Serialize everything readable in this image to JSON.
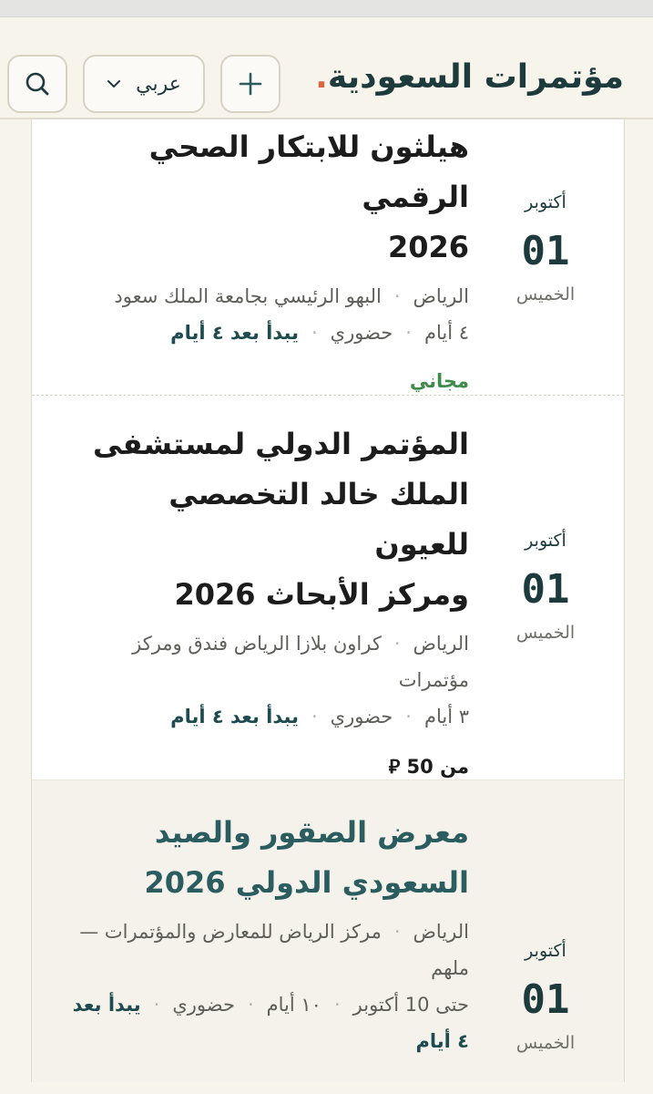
{
  "header": {
    "logo_text": "مؤتمرات السعودية",
    "logo_dot": ".",
    "add_button_icon": "plus-icon",
    "language_label": "عربي",
    "language_icon": "chevron-down-icon",
    "search_icon": "search-icon"
  },
  "colors": {
    "accent": "#d9663f",
    "brand_dark": "#1d3a3c",
    "brand_teal": "#2b5d60",
    "free_green": "#3f8b4c"
  },
  "events": [
    {
      "month": "أكتوبر",
      "day": "01",
      "weekday": "الخميس",
      "title_line1": "هيلثون للابتكار الصحي الرقمي",
      "title_line2": "2026",
      "city": "الرياض",
      "venue": "البهو الرئيسي بجامعة الملك سعود",
      "duration": "٤ أيام",
      "mode": "حضوري",
      "starts": "يبدأ بعد ٤ أيام",
      "price": "مجاني"
    },
    {
      "month": "أكتوبر",
      "day": "01",
      "weekday": "الخميس",
      "title_line1": "المؤتمر الدولي لمستشفى",
      "title_line2": "الملك خالد التخصصي للعيون",
      "title_line3": "ومركز الأبحاث 2026",
      "city": "الرياض",
      "venue_line1": "كراون بلازا الرياض فندق ومركز",
      "venue_line2": "مؤتمرات",
      "duration": "٣ أيام",
      "mode": "حضوري",
      "starts": "يبدأ بعد ٤ أيام",
      "price": "من 50 ⃁"
    },
    {
      "month": "أكتوبر",
      "day": "01",
      "weekday": "الخميس",
      "title_line1": "معرض الصقور والصيد",
      "title_line2": "السعودي الدولي 2026",
      "city": "الرياض",
      "venue_line1": "مركز الرياض للمعارض والمؤتمرات —",
      "venue_line2": "ملهم",
      "until": "حتى 10 أكتوبر",
      "duration": "١٠ أيام",
      "mode": "حضوري",
      "starts_part1": "يبدأ بعد",
      "starts_part2": "٤ أيام"
    }
  ]
}
